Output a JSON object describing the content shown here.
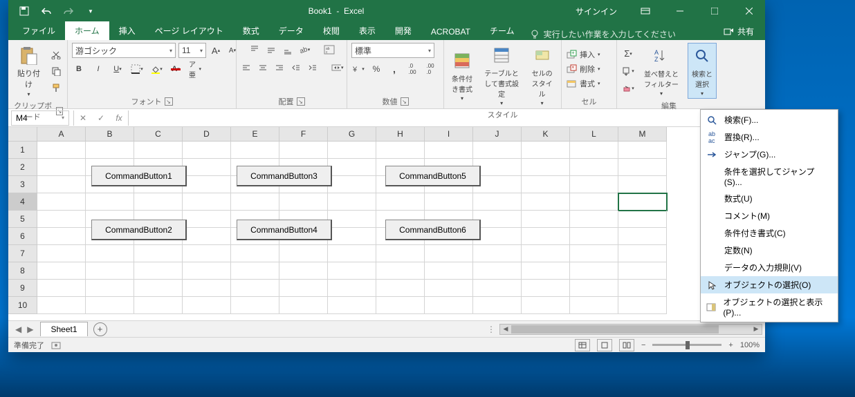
{
  "title": {
    "doc": "Book1",
    "app": "Excel",
    "signin": "サインイン"
  },
  "tabs": {
    "file": "ファイル",
    "home": "ホーム",
    "insert": "挿入",
    "layout": "ページ レイアウト",
    "formulas": "数式",
    "data": "データ",
    "review": "校閲",
    "view": "表示",
    "dev": "開発",
    "acrobat": "ACROBAT",
    "team": "チーム",
    "tell": "実行したい作業を入力してください",
    "share": "共有"
  },
  "ribbon": {
    "clipboard": {
      "paste": "貼り付け",
      "label": "クリップボード"
    },
    "font": {
      "name": "游ゴシック",
      "size": "11",
      "label": "フォント",
      "ruby": "ア亜"
    },
    "align": {
      "label": "配置"
    },
    "number": {
      "format": "標準",
      "label": "数値"
    },
    "styles": {
      "cond": "条件付き書式",
      "tfmt": "テーブルとして書式設定",
      "cstyle": "セルのスタイル",
      "label": "スタイル"
    },
    "cells": {
      "insert": "挿入",
      "delete": "削除",
      "format": "書式",
      "label": "セル"
    },
    "editing": {
      "sort": "並べ替えとフィルター",
      "find": "検索と選択",
      "label": "編集"
    }
  },
  "namebox": "M4",
  "cols": [
    "A",
    "B",
    "C",
    "D",
    "E",
    "F",
    "G",
    "H",
    "I",
    "J",
    "K",
    "L",
    "M"
  ],
  "rows": [
    "1",
    "2",
    "3",
    "4",
    "5",
    "6",
    "7",
    "8",
    "9",
    "10"
  ],
  "buttons": {
    "b1": "CommandButton1",
    "b2": "CommandButton2",
    "b3": "CommandButton3",
    "b4": "CommandButton4",
    "b5": "CommandButton5",
    "b6": "CommandButton6"
  },
  "sheet": {
    "name": "Sheet1"
  },
  "status": {
    "ready": "準備完了",
    "zoom": "100%"
  },
  "menu": {
    "find": "検索(F)...",
    "replace": "置換(R)...",
    "goto": "ジャンプ(G)...",
    "gotospecial": "条件を選択してジャンプ(S)...",
    "formulas": "数式(U)",
    "comments": "コメント(M)",
    "condfmt": "条件付き書式(C)",
    "constants": "定数(N)",
    "validation": "データの入力規則(V)",
    "selobj": "オブジェクトの選択(O)",
    "selpane": "オブジェクトの選択と表示(P)..."
  }
}
